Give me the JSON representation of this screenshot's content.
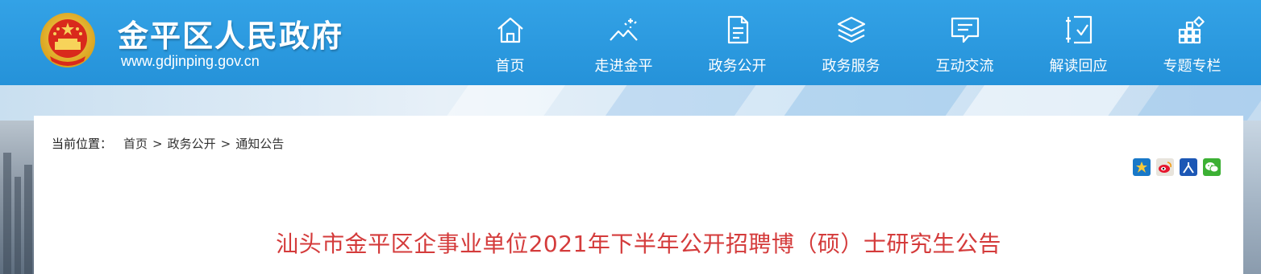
{
  "header": {
    "site_title": "金平区人民政府",
    "site_url": "www.gdjinping.gov.cn"
  },
  "nav": {
    "items": [
      {
        "label": "首页",
        "icon": "home-icon"
      },
      {
        "label": "走进金平",
        "icon": "sparkle-mountain-icon"
      },
      {
        "label": "政务公开",
        "icon": "document-icon"
      },
      {
        "label": "政务服务",
        "icon": "layers-icon"
      },
      {
        "label": "互动交流",
        "icon": "message-icon"
      },
      {
        "label": "解读回应",
        "icon": "checklist-icon"
      },
      {
        "label": "专题专栏",
        "icon": "grid-icon"
      }
    ]
  },
  "breadcrumb": {
    "label": "当前位置：",
    "items": [
      "首页",
      "政务公开",
      "通知公告"
    ],
    "separator": ">"
  },
  "share": {
    "buttons": [
      "qzone-icon",
      "weibo-icon",
      "people-icon",
      "wechat-icon"
    ]
  },
  "article": {
    "title": "汕头市金平区企事业单位2021年下半年公开招聘博（硕）士研究生公告"
  },
  "colors": {
    "header_bg": "#2592d9",
    "title_red": "#d43b3b",
    "panel_bg": "#ffffff"
  }
}
